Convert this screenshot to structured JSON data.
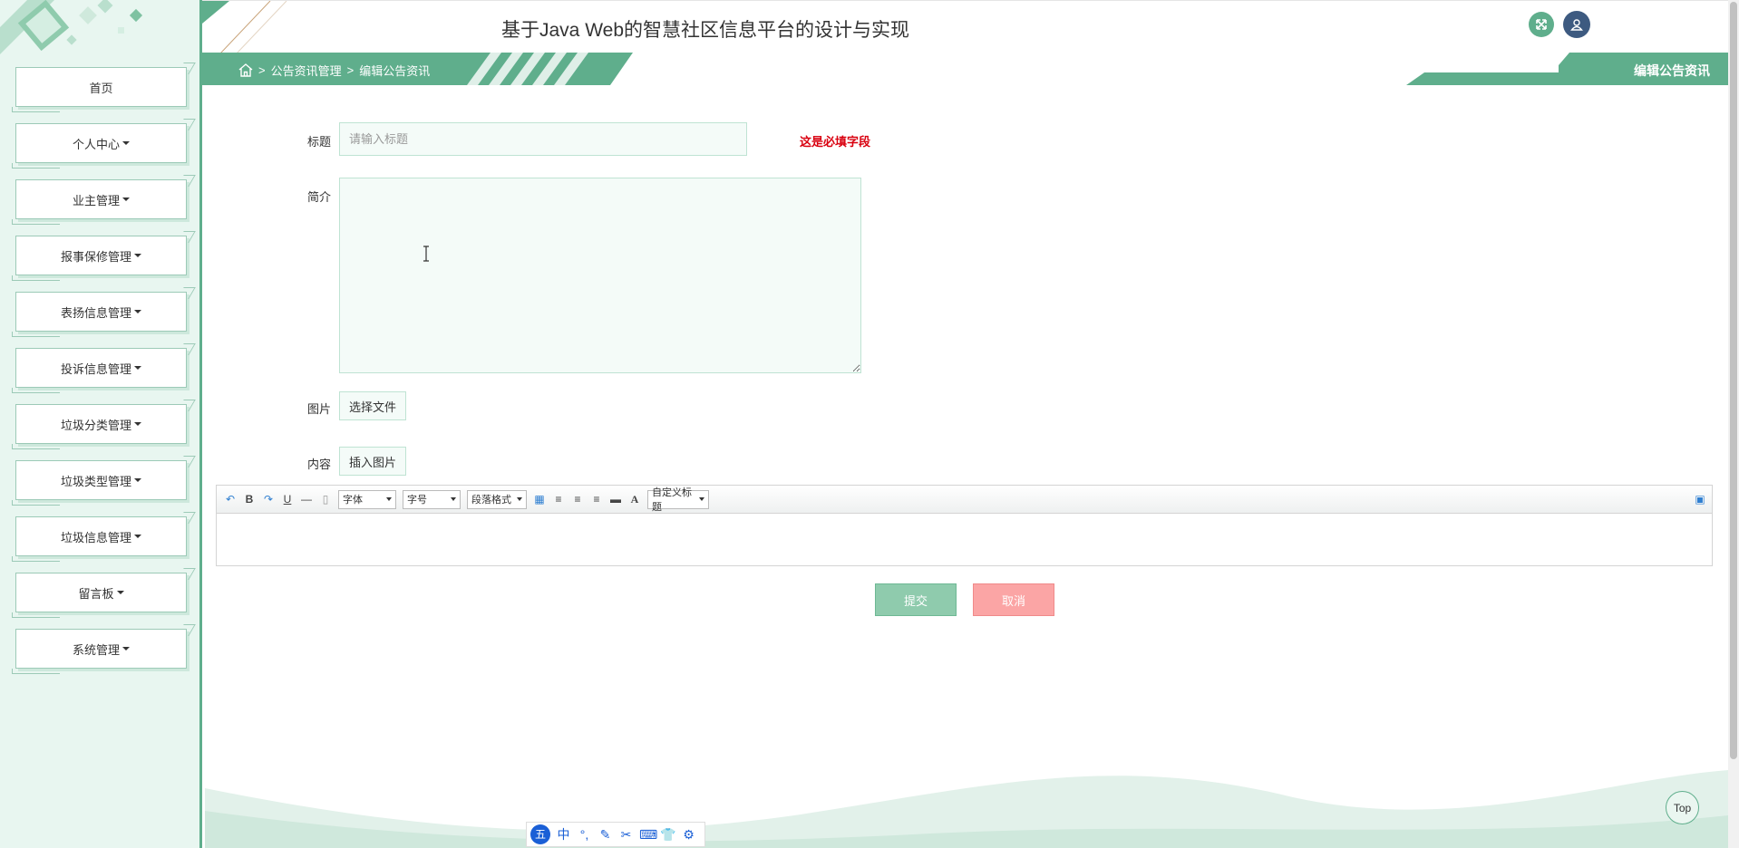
{
  "app": {
    "title": "基于Java Web的智慧社区信息平台的设计与实现"
  },
  "sidebar": {
    "items": [
      {
        "label": "首页",
        "dropdown": false
      },
      {
        "label": "个人中心",
        "dropdown": true
      },
      {
        "label": "业主管理",
        "dropdown": true
      },
      {
        "label": "报事保修管理",
        "dropdown": true
      },
      {
        "label": "表扬信息管理",
        "dropdown": true
      },
      {
        "label": "投诉信息管理",
        "dropdown": true
      },
      {
        "label": "垃圾分类管理",
        "dropdown": true
      },
      {
        "label": "垃圾类型管理",
        "dropdown": true
      },
      {
        "label": "垃圾信息管理",
        "dropdown": true
      },
      {
        "label": "留言板",
        "dropdown": true
      },
      {
        "label": "系统管理",
        "dropdown": true
      }
    ]
  },
  "breadcrumb": {
    "sep": ">",
    "section": "公告资讯管理",
    "page": "编辑公告资讯"
  },
  "page_tag": "编辑公告资讯",
  "form": {
    "title_label": "标题",
    "title_placeholder": "请输入标题",
    "title_value": "",
    "required_msg": "这是必填字段",
    "summary_label": "简介",
    "image_label": "图片",
    "choose_file": "选择文件",
    "content_label": "内容",
    "insert_image": "插入图片"
  },
  "editor": {
    "font_family": "字体",
    "font_size": "字号",
    "paragraph": "段落格式",
    "custom_title": "自定义标题"
  },
  "actions": {
    "submit": "提交",
    "cancel": "取消"
  },
  "top_button": "Top",
  "colors": {
    "accent": "#5fae8c",
    "submit": "#8fcbad",
    "cancel": "#fba5a5",
    "error": "#d9000f",
    "avatar": "#3d5a80"
  }
}
